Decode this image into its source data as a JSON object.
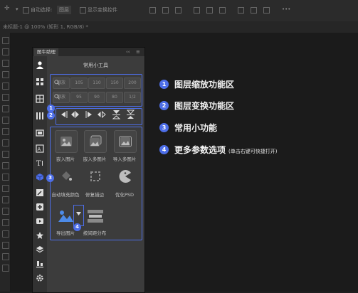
{
  "topbar": {
    "auto_select_label": "自动选择:",
    "layer_select_value": "图层",
    "show_transform_label": "显示变换控件"
  },
  "document": {
    "tab_title": "未标题-1 @ 100% (矩形 1, RGB/8) *"
  },
  "panel": {
    "tab_title": "图牛助理",
    "collapse_glyph": "‹‹",
    "menu_glyph": "≡",
    "section_title": "常用小工具",
    "zoom": {
      "row1": [
        "缩放",
        "105",
        "110",
        "150",
        "200"
      ],
      "row2": [
        "缩放",
        "95",
        "90",
        "80",
        "1/2"
      ]
    },
    "functions": [
      {
        "label": "嵌入图片",
        "icon": "image-icon"
      },
      {
        "label": "嵌入多图片",
        "icon": "images-icon"
      },
      {
        "label": "导入多图片",
        "icon": "import-images-icon"
      },
      {
        "label": "自动填充颜色",
        "icon": "color-fill-icon"
      },
      {
        "label": "修复描边",
        "icon": "stroke-repair-icon"
      },
      {
        "label": "优化PSD",
        "icon": "pacman-icon"
      },
      {
        "label": "导出图片",
        "icon": "export-image-icon"
      },
      {
        "label": "按间距分布",
        "icon": "distribute-icon"
      }
    ]
  },
  "badges": [
    "1",
    "2",
    "3",
    "4"
  ],
  "legend": [
    {
      "num": "1",
      "text": "图层缩放功能区"
    },
    {
      "num": "2",
      "text": "图层变换功能区"
    },
    {
      "num": "3",
      "text": "常用小功能"
    },
    {
      "num": "4",
      "text": "更多参数选项",
      "note": "(单击右键可快捷打开)"
    }
  ],
  "colors": {
    "accent": "#4d6ee8",
    "panel_bg": "#3c3c3c",
    "app_bg": "#1f1f1f"
  }
}
